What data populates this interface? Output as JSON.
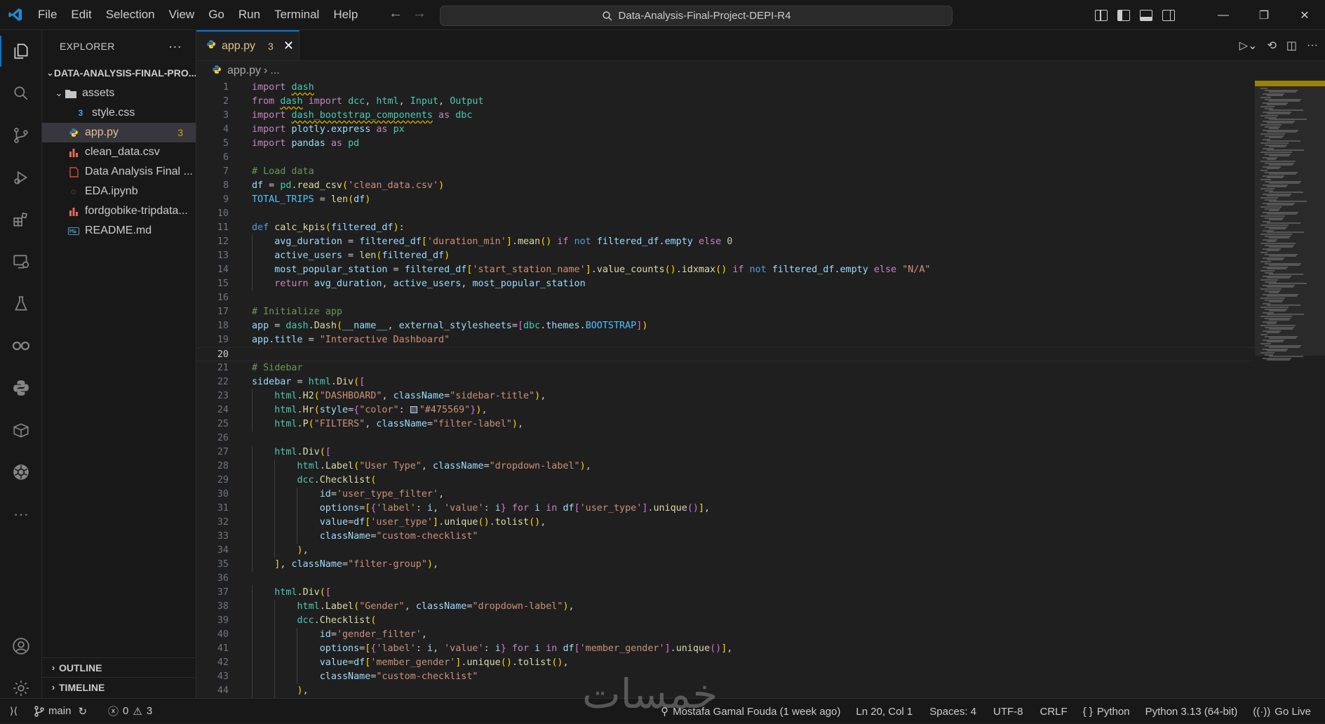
{
  "menu": [
    "File",
    "Edit",
    "Selection",
    "View",
    "Go",
    "Run",
    "Terminal",
    "Help"
  ],
  "search": {
    "text": "Data-Analysis-Final-Project-DEPI-R4"
  },
  "explorer": {
    "header": "EXPLORER",
    "root": "DATA-ANALYSIS-FINAL-PRO...",
    "items": [
      {
        "label": "assets",
        "type": "folder"
      },
      {
        "label": "style.css",
        "type": "css"
      },
      {
        "label": "app.py",
        "type": "python",
        "badge": "3"
      },
      {
        "label": "clean_data.csv",
        "type": "csv"
      },
      {
        "label": "Data Analysis Final ...",
        "type": "pdf"
      },
      {
        "label": "EDA.ipynb",
        "type": "notebook"
      },
      {
        "label": "fordgobike-tripdata...",
        "type": "csv"
      },
      {
        "label": "README.md",
        "type": "markdown"
      }
    ],
    "outline": "OUTLINE",
    "timeline": "TIMELINE"
  },
  "tab": {
    "name": "app.py",
    "problems": "3"
  },
  "breadcrumb": {
    "file": "app.py",
    "rest": "..."
  },
  "code": {
    "current_line": 20,
    "lines": [
      "import dash",
      "from dash import dcc, html, Input, Output",
      "import dash_bootstrap_components as dbc",
      "import plotly.express as px",
      "import pandas as pd",
      "",
      "# Load data",
      "df = pd.read_csv('clean_data.csv')",
      "TOTAL_TRIPS = len(df)",
      "",
      "def calc_kpis(filtered_df):",
      "    avg_duration = filtered_df['duration_min'].mean() if not filtered_df.empty else 0",
      "    active_users = len(filtered_df)",
      "    most_popular_station = filtered_df['start_station_name'].value_counts().idxmax() if not filtered_df.empty else \"N/A\"",
      "    return avg_duration, active_users, most_popular_station",
      "",
      "# Initialize app",
      "app = dash.Dash(__name__, external_stylesheets=[dbc.themes.BOOTSTRAP])",
      "app.title = \"Interactive Dashboard\"",
      "",
      "# Sidebar",
      "sidebar = html.Div([",
      "    html.H2(\"DASHBOARD\", className=\"sidebar-title\"),",
      "    html.Hr(style={\"color\": \"#475569\"}),",
      "    html.P(\"FILTERS\", className=\"filter-label\"),",
      "",
      "    html.Div([",
      "        html.Label(\"User Type\", className=\"dropdown-label\"),",
      "        dcc.Checklist(",
      "            id='user_type_filter',",
      "            options=[{'label': i, 'value': i} for i in df['user_type'].unique()],",
      "            value=df['user_type'].unique().tolist(),",
      "            className=\"custom-checklist\"",
      "        ),",
      "    ], className=\"filter-group\"),",
      "",
      "    html.Div([",
      "        html.Label(\"Gender\", className=\"dropdown-label\"),",
      "        dcc.Checklist(",
      "            id='gender_filter',",
      "            options=[{'label': i, 'value': i} for i in df['member_gender'].unique()],",
      "            value=df['member_gender'].unique().tolist(),",
      "            className=\"custom-checklist\"",
      "        ),"
    ]
  },
  "status": {
    "branch": "main",
    "errors": "0",
    "warnings": "3",
    "blame": "Mostafa Gamal Fouda (1 week ago)",
    "position": "Ln 20, Col 1",
    "spaces": "Spaces: 4",
    "encoding": "UTF-8",
    "eol": "CRLF",
    "language": "Python",
    "interpreter": "Python 3.13 (64-bit)",
    "golive": "Go Live"
  },
  "watermark": "خمسات"
}
